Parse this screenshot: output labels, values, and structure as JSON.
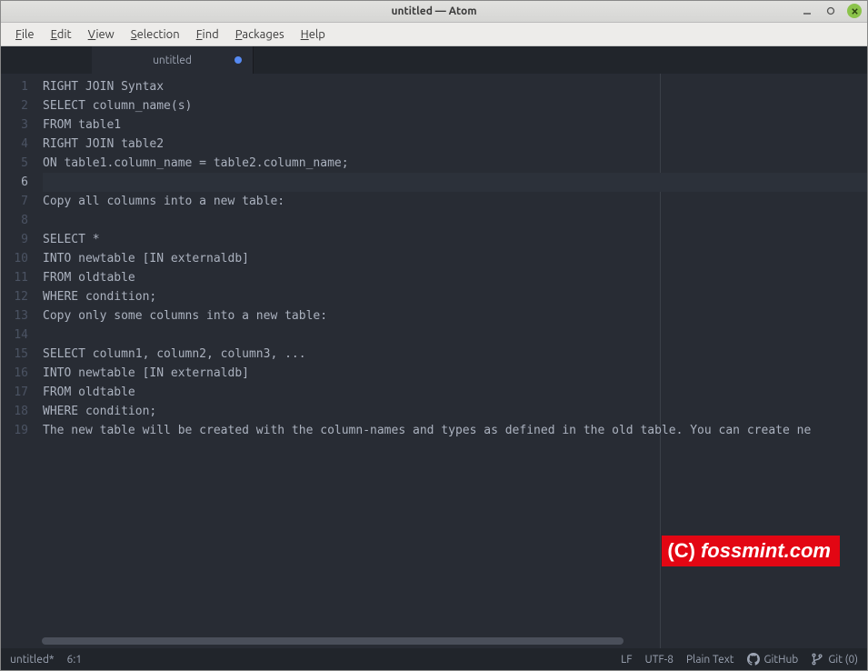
{
  "window": {
    "title": "untitled — Atom"
  },
  "menus": {
    "file": "File",
    "edit": "Edit",
    "view": "View",
    "selection": "Selection",
    "find": "Find",
    "packages": "Packages",
    "help": "Help"
  },
  "tab": {
    "title": "untitled"
  },
  "code_lines": [
    "RIGHT JOIN Syntax",
    "SELECT column_name(s)",
    "FROM table1",
    "RIGHT JOIN table2",
    "ON table1.column_name = table2.column_name;",
    "",
    "Copy all columns into a new table:",
    "",
    "SELECT *",
    "INTO newtable [IN externaldb]",
    "FROM oldtable",
    "WHERE condition;",
    "Copy only some columns into a new table:",
    "",
    "SELECT column1, column2, column3, ...",
    "INTO newtable [IN externaldb]",
    "FROM oldtable",
    "WHERE condition;",
    "The new table will be created with the column-names and types as defined in the old table. You can create ne"
  ],
  "active_line_index": 5,
  "statusbar": {
    "filename": "untitled*",
    "cursor": "6:1",
    "line_ending": "LF",
    "encoding": "UTF-8",
    "grammar": "Plain Text",
    "github": "GitHub",
    "git": "Git (0)"
  },
  "watermark": {
    "c": "(C)",
    "text": "fossmint.com"
  }
}
